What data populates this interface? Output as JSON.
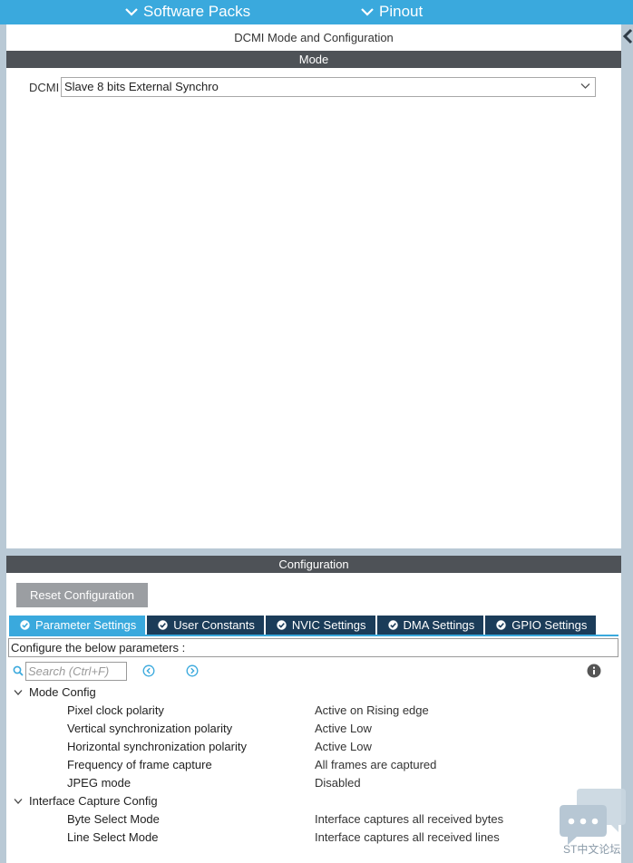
{
  "topbar": {
    "software_packs": "Software Packs",
    "pinout": "Pinout"
  },
  "panel": {
    "title": "DCMI Mode and Configuration",
    "mode_header": "Mode",
    "dcmi_label": "DCMI",
    "dcmi_value": "Slave 8 bits External Synchro",
    "configuration_header": "Configuration"
  },
  "config": {
    "reset_button": "Reset Configuration",
    "tabs": [
      {
        "label": "Parameter Settings",
        "active": true
      },
      {
        "label": "User Constants",
        "active": false
      },
      {
        "label": "NVIC Settings",
        "active": false
      },
      {
        "label": "DMA Settings",
        "active": false
      },
      {
        "label": "GPIO Settings",
        "active": false
      }
    ],
    "configure_text": "Configure the below parameters :",
    "search_placeholder": "Search (Ctrl+F)"
  },
  "tree": {
    "groups": [
      {
        "label": "Mode Config",
        "params": [
          {
            "name": "Pixel clock polarity",
            "value": "Active on Rising edge"
          },
          {
            "name": "Vertical synchronization polarity",
            "value": "Active Low"
          },
          {
            "name": "Horizontal synchronization polarity",
            "value": "Active Low"
          },
          {
            "name": "Frequency of frame capture",
            "value": "All frames are captured"
          },
          {
            "name": "JPEG mode",
            "value": "Disabled"
          }
        ]
      },
      {
        "label": "Interface Capture Config",
        "params": [
          {
            "name": "Byte Select Mode",
            "value": "Interface captures all received bytes"
          },
          {
            "name": "Line Select Mode",
            "value": "Interface captures all received lines"
          }
        ]
      }
    ]
  },
  "watermark": {
    "text": "ST中文论坛"
  },
  "colors": {
    "topbar": "#3aa9dd",
    "section_bar": "#4e5257",
    "tab_inactive": "#1b3c59",
    "tab_active": "#3aa9dd",
    "reset_button": "#9b9ea2"
  }
}
